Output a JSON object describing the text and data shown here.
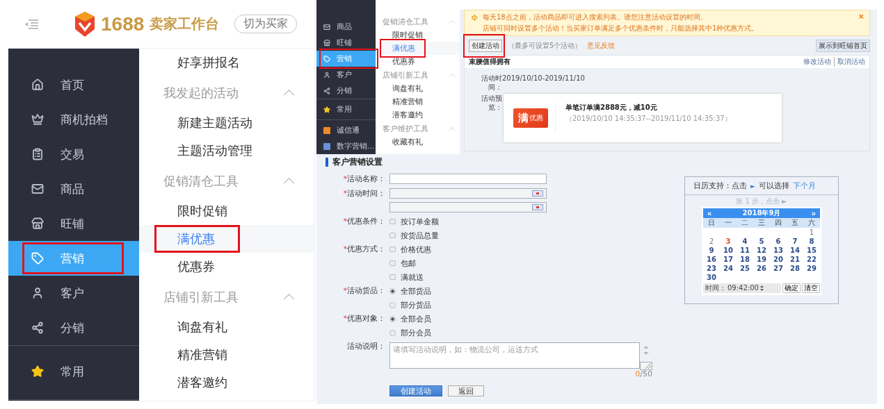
{
  "app_header": {
    "brand_number": "1688",
    "brand_title": "卖家工作台",
    "switch_button": "切为买家"
  },
  "sidebar": {
    "sections": [
      [
        {
          "label": "首页",
          "selected": false,
          "highlighted": false
        },
        {
          "label": "商机拍档",
          "selected": false,
          "highlighted": false
        },
        {
          "label": "交易",
          "selected": false,
          "highlighted": false
        },
        {
          "label": "商品",
          "selected": false,
          "highlighted": false
        },
        {
          "label": "旺铺",
          "selected": false,
          "highlighted": false
        },
        {
          "label": "营销",
          "selected": true,
          "highlighted": true
        },
        {
          "label": "客户",
          "selected": false,
          "highlighted": false
        },
        {
          "label": "分销",
          "selected": false,
          "highlighted": false
        }
      ],
      [
        {
          "label": "常用",
          "selected": false,
          "highlighted": false
        }
      ]
    ]
  },
  "submenu": {
    "items": [
      {
        "kind": "item",
        "label": "好享拼报名",
        "selected": false,
        "highlighted": false
      },
      {
        "kind": "group",
        "label": "我发起的活动",
        "expanded": true
      },
      {
        "kind": "item",
        "label": "新建主题活动",
        "selected": false,
        "highlighted": false
      },
      {
        "kind": "item",
        "label": "主题活动管理",
        "selected": false,
        "highlighted": false
      },
      {
        "kind": "group",
        "label": "促销清仓工具",
        "expanded": true
      },
      {
        "kind": "item",
        "label": "限时促销",
        "selected": false,
        "highlighted": false
      },
      {
        "kind": "item",
        "label": "满优惠",
        "selected": true,
        "highlighted": true
      },
      {
        "kind": "item",
        "label": "优惠券",
        "selected": false,
        "highlighted": false
      },
      {
        "kind": "group",
        "label": "店铺引新工具",
        "expanded": true
      },
      {
        "kind": "item",
        "label": "询盘有礼",
        "selected": false,
        "highlighted": false
      },
      {
        "kind": "item",
        "label": "精准营销",
        "selected": false,
        "highlighted": false
      },
      {
        "kind": "item",
        "label": "潜客邀约",
        "selected": false,
        "highlighted": false
      }
    ]
  },
  "mini_sidebar": {
    "sections": [
      [
        {
          "label": "商品",
          "selected": false,
          "highlighted": false
        },
        {
          "label": "旺铺",
          "selected": false,
          "highlighted": false
        },
        {
          "label": "营销",
          "selected": true,
          "highlighted": true
        },
        {
          "label": "客户",
          "selected": false,
          "highlighted": false
        },
        {
          "label": "分销",
          "selected": false,
          "highlighted": false
        }
      ],
      [
        {
          "label": "常用",
          "selected": false,
          "highlighted": false
        }
      ],
      [
        {
          "label": "诚信通",
          "selected": false,
          "highlighted": false
        },
        {
          "label": "数字营销...",
          "selected": false,
          "highlighted": false
        }
      ]
    ]
  },
  "mini_submenu": {
    "items": [
      {
        "kind": "group",
        "label": "促销清仓工具",
        "expanded": true
      },
      {
        "kind": "item",
        "label": "限时促销",
        "selected": false,
        "highlighted": false
      },
      {
        "kind": "item",
        "label": "满优惠",
        "selected": true,
        "highlighted": true
      },
      {
        "kind": "item",
        "label": "优惠券",
        "selected": false,
        "highlighted": false
      },
      {
        "kind": "group",
        "label": "店铺引新工具",
        "expanded": true
      },
      {
        "kind": "item",
        "label": "询盘有礼",
        "selected": false,
        "highlighted": false
      },
      {
        "kind": "item",
        "label": "精准营销",
        "selected": false,
        "highlighted": false
      },
      {
        "kind": "item",
        "label": "潜客邀约",
        "selected": false,
        "highlighted": false
      },
      {
        "kind": "group",
        "label": "客户维护工具",
        "expanded": true
      },
      {
        "kind": "item",
        "label": "收藏有礼",
        "selected": false,
        "highlighted": false
      }
    ]
  },
  "notice": {
    "lines": [
      "每天18点之前，活动商品即可进入搜索列表。请您注意活动设置的时间。",
      "店铺可同时设置多个活动！当买家订单满足多个优惠条件时，只能选择其中1种优惠方式。"
    ],
    "close": "×"
  },
  "toolbar": {
    "create_button": {
      "label": "创建活动",
      "highlighted": true
    },
    "hint": "（最多可设置5个活动）",
    "feedback_link": "意见反馈",
    "showcase_button": "展示到旺铺首页"
  },
  "activity_card": {
    "title": "束腰值得拥有",
    "actions": [
      "修改活动",
      "取消活动"
    ],
    "time_label": "活动时间：",
    "time_value": "2019/10/10-2019/11/10",
    "preview_label": "活动预览：",
    "badge_main": "满",
    "badge_sub": "优惠",
    "offer": "单笔订单满**2888**元，减**10**元",
    "period": "（2019/10/10 14:35:37--2019/11/10 14:35:37）"
  },
  "form": {
    "title": "客户营销设置",
    "fields": [
      {
        "kind": "text",
        "required_mark": "*",
        "label": "活动名称："
      },
      {
        "kind": "date_range",
        "required_mark": "*",
        "label": "活动时间："
      },
      {
        "kind": "checkbox",
        "required_mark": "*",
        "label": "优惠条件：",
        "options": [
          {
            "label": "按订单金额",
            "checked": false
          },
          {
            "label": "按货品总量",
            "checked": false
          }
        ]
      },
      {
        "kind": "checkbox",
        "required_mark": "*",
        "label": "优惠方式：",
        "options": [
          {
            "label": "价格优惠",
            "checked": false
          },
          {
            "label": "包邮",
            "checked": false
          },
          {
            "label": "满就送",
            "checked": false
          }
        ]
      },
      {
        "kind": "radio",
        "required_mark": "*",
        "label": "活动货品：",
        "options": [
          {
            "label": "全部货品",
            "selected": true
          },
          {
            "label": "部分货品",
            "selected": false
          }
        ]
      },
      {
        "kind": "radio",
        "required_mark": "*",
        "label": "优惠对象：",
        "options": [
          {
            "label": "全部会员",
            "selected": true
          },
          {
            "label": "部分会员",
            "selected": false
          }
        ]
      },
      {
        "kind": "textarea",
        "label": "活动说明：",
        "placeholder": "请填写活动说明，如：物流公司，运送方式",
        "counter_used": "0",
        "counter_total": "/50"
      }
    ],
    "buttons": [
      {
        "label": "创建活动",
        "kind": "primary"
      },
      {
        "label": "返回",
        "kind": "default"
      }
    ]
  },
  "calendar_help": {
    "intro": "日历支持：点击",
    "arrow": "►",
    "middle": "可以选择",
    "link": "下个月",
    "step": "第 1 步，点击 ►",
    "calendar": {
      "prev": "«",
      "month": "2018年9月",
      "next": "»",
      "weekdays": [
        "日",
        "一",
        "二",
        "三",
        "四",
        "五",
        "六"
      ],
      "weeks": [
        {
          "kind": "start",
          "days": [
            {
              "label": "1",
              "past": true,
              "today": false
            }
          ]
        },
        {
          "kind": "full",
          "days": [
            {
              "label": "2",
              "past": true,
              "today": false
            },
            {
              "label": "3",
              "past": false,
              "today": true
            },
            {
              "label": "4",
              "past": false,
              "today": false
            },
            {
              "label": "5",
              "past": false,
              "today": false
            },
            {
              "label": "6",
              "past": false,
              "today": false
            },
            {
              "label": "7",
              "past": false,
              "today": false
            },
            {
              "label": "8",
              "past": false,
              "today": false
            }
          ]
        },
        {
          "kind": "full",
          "days": [
            {
              "label": "9",
              "past": false,
              "today": false
            },
            {
              "label": "10",
              "past": false,
              "today": false
            },
            {
              "label": "11",
              "past": false,
              "today": false
            },
            {
              "label": "12",
              "past": false,
              "today": false
            },
            {
              "label": "13",
              "past": false,
              "today": false
            },
            {
              "label": "14",
              "past": false,
              "today": false
            },
            {
              "label": "15",
              "past": false,
              "today": false
            }
          ]
        },
        {
          "kind": "full",
          "days": [
            {
              "label": "16",
              "past": false,
              "today": false
            },
            {
              "label": "17",
              "past": false,
              "today": false
            },
            {
              "label": "18",
              "past": false,
              "today": false
            },
            {
              "label": "19",
              "past": false,
              "today": false
            },
            {
              "label": "20",
              "past": false,
              "today": false
            },
            {
              "label": "21",
              "past": false,
              "today": false
            },
            {
              "label": "22",
              "past": false,
              "today": false
            }
          ]
        },
        {
          "kind": "full",
          "days": [
            {
              "label": "23",
              "past": false,
              "today": false
            },
            {
              "label": "24",
              "past": false,
              "today": false
            },
            {
              "label": "25",
              "past": false,
              "today": false
            },
            {
              "label": "26",
              "past": false,
              "today": false
            },
            {
              "label": "27",
              "past": false,
              "today": false
            },
            {
              "label": "28",
              "past": false,
              "today": false
            },
            {
              "label": "29",
              "past": false,
              "today": false
            }
          ]
        },
        {
          "kind": "end",
          "days": [
            {
              "label": "30",
              "past": false,
              "today": false
            }
          ]
        }
      ],
      "time_label": "时间：",
      "time_value": "09:42:00",
      "confirm": "确定",
      "clear": "清空"
    }
  }
}
